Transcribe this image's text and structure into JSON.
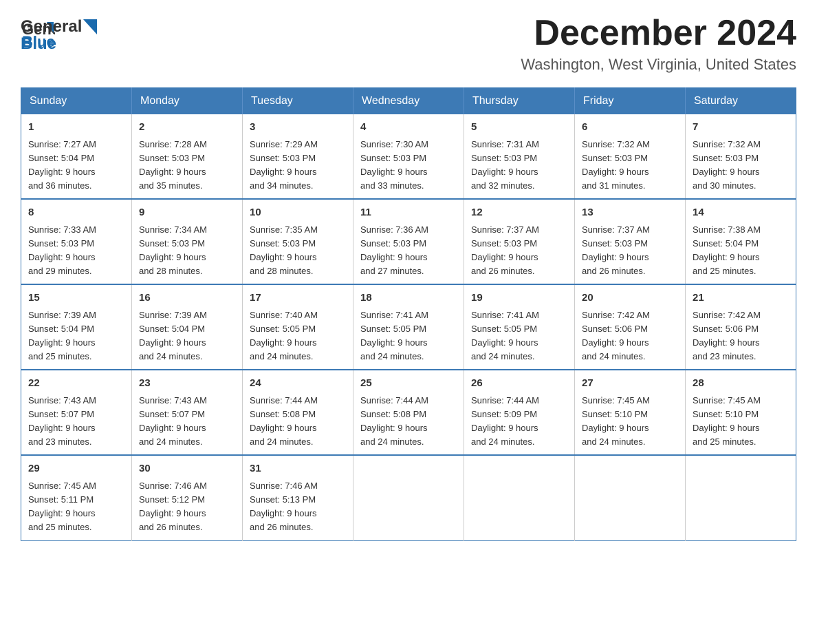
{
  "logo": {
    "text_general": "General",
    "text_blue": "Blue"
  },
  "title": {
    "month_year": "December 2024",
    "location": "Washington, West Virginia, United States"
  },
  "weekdays": [
    "Sunday",
    "Monday",
    "Tuesday",
    "Wednesday",
    "Thursday",
    "Friday",
    "Saturday"
  ],
  "weeks": [
    [
      {
        "day": "1",
        "sunrise": "7:27 AM",
        "sunset": "5:04 PM",
        "daylight": "9 hours and 36 minutes."
      },
      {
        "day": "2",
        "sunrise": "7:28 AM",
        "sunset": "5:03 PM",
        "daylight": "9 hours and 35 minutes."
      },
      {
        "day": "3",
        "sunrise": "7:29 AM",
        "sunset": "5:03 PM",
        "daylight": "9 hours and 34 minutes."
      },
      {
        "day": "4",
        "sunrise": "7:30 AM",
        "sunset": "5:03 PM",
        "daylight": "9 hours and 33 minutes."
      },
      {
        "day": "5",
        "sunrise": "7:31 AM",
        "sunset": "5:03 PM",
        "daylight": "9 hours and 32 minutes."
      },
      {
        "day": "6",
        "sunrise": "7:32 AM",
        "sunset": "5:03 PM",
        "daylight": "9 hours and 31 minutes."
      },
      {
        "day": "7",
        "sunrise": "7:32 AM",
        "sunset": "5:03 PM",
        "daylight": "9 hours and 30 minutes."
      }
    ],
    [
      {
        "day": "8",
        "sunrise": "7:33 AM",
        "sunset": "5:03 PM",
        "daylight": "9 hours and 29 minutes."
      },
      {
        "day": "9",
        "sunrise": "7:34 AM",
        "sunset": "5:03 PM",
        "daylight": "9 hours and 28 minutes."
      },
      {
        "day": "10",
        "sunrise": "7:35 AM",
        "sunset": "5:03 PM",
        "daylight": "9 hours and 28 minutes."
      },
      {
        "day": "11",
        "sunrise": "7:36 AM",
        "sunset": "5:03 PM",
        "daylight": "9 hours and 27 minutes."
      },
      {
        "day": "12",
        "sunrise": "7:37 AM",
        "sunset": "5:03 PM",
        "daylight": "9 hours and 26 minutes."
      },
      {
        "day": "13",
        "sunrise": "7:37 AM",
        "sunset": "5:03 PM",
        "daylight": "9 hours and 26 minutes."
      },
      {
        "day": "14",
        "sunrise": "7:38 AM",
        "sunset": "5:04 PM",
        "daylight": "9 hours and 25 minutes."
      }
    ],
    [
      {
        "day": "15",
        "sunrise": "7:39 AM",
        "sunset": "5:04 PM",
        "daylight": "9 hours and 25 minutes."
      },
      {
        "day": "16",
        "sunrise": "7:39 AM",
        "sunset": "5:04 PM",
        "daylight": "9 hours and 24 minutes."
      },
      {
        "day": "17",
        "sunrise": "7:40 AM",
        "sunset": "5:05 PM",
        "daylight": "9 hours and 24 minutes."
      },
      {
        "day": "18",
        "sunrise": "7:41 AM",
        "sunset": "5:05 PM",
        "daylight": "9 hours and 24 minutes."
      },
      {
        "day": "19",
        "sunrise": "7:41 AM",
        "sunset": "5:05 PM",
        "daylight": "9 hours and 24 minutes."
      },
      {
        "day": "20",
        "sunrise": "7:42 AM",
        "sunset": "5:06 PM",
        "daylight": "9 hours and 24 minutes."
      },
      {
        "day": "21",
        "sunrise": "7:42 AM",
        "sunset": "5:06 PM",
        "daylight": "9 hours and 23 minutes."
      }
    ],
    [
      {
        "day": "22",
        "sunrise": "7:43 AM",
        "sunset": "5:07 PM",
        "daylight": "9 hours and 23 minutes."
      },
      {
        "day": "23",
        "sunrise": "7:43 AM",
        "sunset": "5:07 PM",
        "daylight": "9 hours and 24 minutes."
      },
      {
        "day": "24",
        "sunrise": "7:44 AM",
        "sunset": "5:08 PM",
        "daylight": "9 hours and 24 minutes."
      },
      {
        "day": "25",
        "sunrise": "7:44 AM",
        "sunset": "5:08 PM",
        "daylight": "9 hours and 24 minutes."
      },
      {
        "day": "26",
        "sunrise": "7:44 AM",
        "sunset": "5:09 PM",
        "daylight": "9 hours and 24 minutes."
      },
      {
        "day": "27",
        "sunrise": "7:45 AM",
        "sunset": "5:10 PM",
        "daylight": "9 hours and 24 minutes."
      },
      {
        "day": "28",
        "sunrise": "7:45 AM",
        "sunset": "5:10 PM",
        "daylight": "9 hours and 25 minutes."
      }
    ],
    [
      {
        "day": "29",
        "sunrise": "7:45 AM",
        "sunset": "5:11 PM",
        "daylight": "9 hours and 25 minutes."
      },
      {
        "day": "30",
        "sunrise": "7:46 AM",
        "sunset": "5:12 PM",
        "daylight": "9 hours and 26 minutes."
      },
      {
        "day": "31",
        "sunrise": "7:46 AM",
        "sunset": "5:13 PM",
        "daylight": "9 hours and 26 minutes."
      },
      null,
      null,
      null,
      null
    ]
  ]
}
